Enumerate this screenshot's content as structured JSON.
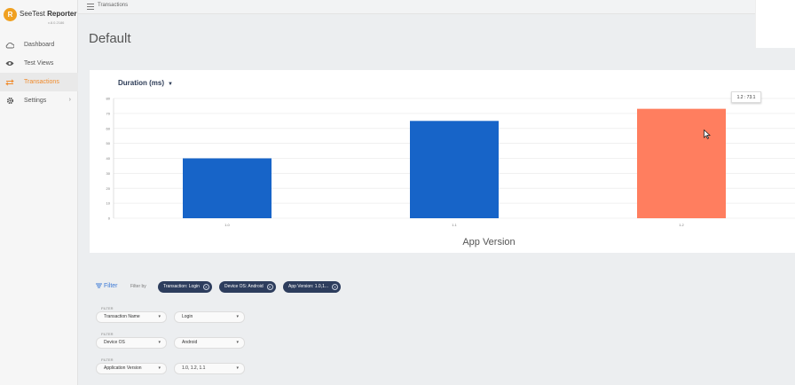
{
  "app": {
    "logo_mark": "R",
    "name_light": "SeeTest ",
    "name_bold": "Reporter",
    "version": "v.8.0.2186"
  },
  "sidebar": {
    "items": [
      {
        "label": "Dashboard",
        "icon": "cloud-icon",
        "active": false
      },
      {
        "label": "Test Views",
        "icon": "eye-icon",
        "active": false
      },
      {
        "label": "Transactions",
        "icon": "transfer-arrows-icon",
        "active": true
      },
      {
        "label": "Settings",
        "icon": "gear-icon",
        "active": false,
        "chevron": "›"
      }
    ]
  },
  "topbar": {
    "breadcrumb": "Transactions"
  },
  "page": {
    "title": "Default"
  },
  "chart_section": {
    "metric_label": "Duration (ms)",
    "metric_caret": "▼",
    "tooltip": "1.2 : 73.1"
  },
  "chart_data": {
    "type": "bar",
    "categories": [
      "1.0",
      "1.1",
      "1.2"
    ],
    "values": [
      40,
      65,
      73.1
    ],
    "colors": [
      "#1764c8",
      "#1764c8",
      "#ff7e5f"
    ],
    "xlabel": "App Version",
    "ylabel": "",
    "ylim": [
      0,
      80
    ],
    "yticks": [
      0,
      10,
      20,
      30,
      40,
      50,
      60,
      70,
      80
    ],
    "grid": true
  },
  "filter": {
    "button_label": "Filter",
    "filter_by_label": "Filter by",
    "chips": [
      {
        "label": "Transaction: Login"
      },
      {
        "label": "Device OS: Android"
      },
      {
        "label": "App Version: 1.0,1..."
      }
    ],
    "rows": [
      {
        "small_label": "FILTER",
        "field": "Transaction Name",
        "value": "Login"
      },
      {
        "small_label": "FILTER",
        "field": "Device OS",
        "value": "Android"
      },
      {
        "small_label": "FILTER",
        "field": "Application Version",
        "value": "1.0, 1.2, 1.1"
      }
    ],
    "dropdown_caret": "▾",
    "chip_close": "✕"
  }
}
